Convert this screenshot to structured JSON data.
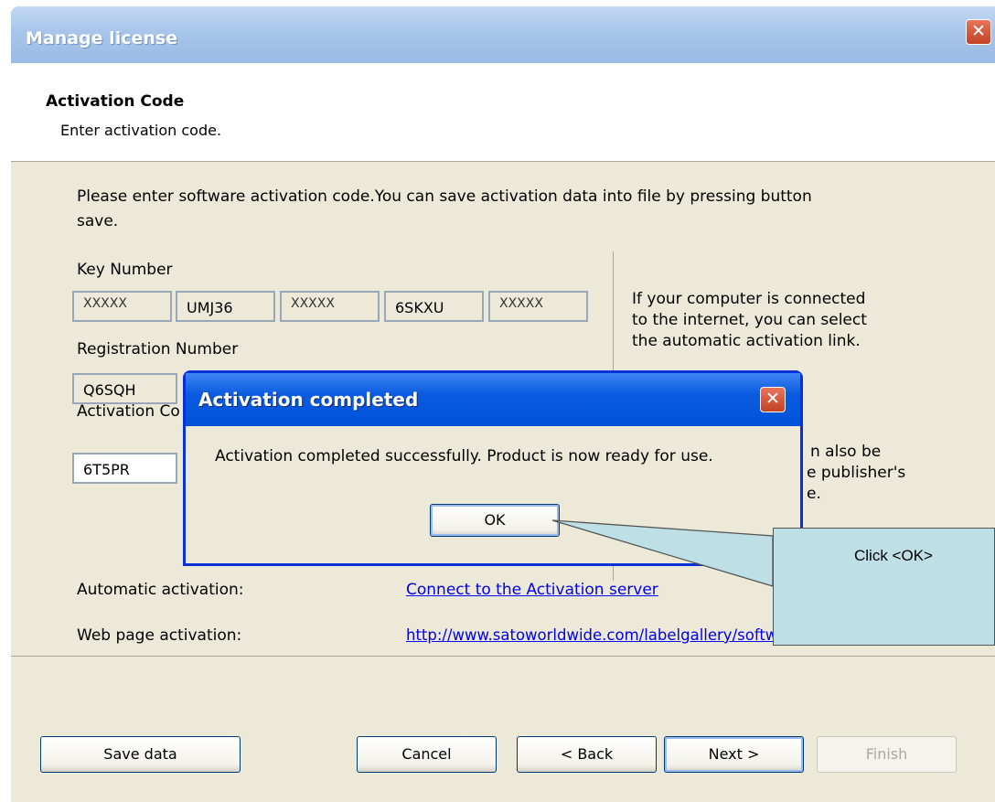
{
  "window": {
    "title": "Manage license",
    "close_label": "✕"
  },
  "header": {
    "title": "Activation Code",
    "subtitle": "Enter activation code."
  },
  "intro": {
    "line1": "Please enter software activation code.You can save activation data into file by pressing button",
    "line2": "save."
  },
  "key_number": {
    "label": "Key Number",
    "parts": [
      "XXXXX",
      "UMJ36",
      "XXXXX",
      "6SKXU",
      "XXXXX"
    ]
  },
  "registration_number": {
    "label": "Registration Number",
    "first": "Q6SQH"
  },
  "activation_code": {
    "label": "Activation Co",
    "first": "6T5PR"
  },
  "info": {
    "line1": "If your computer is connected",
    "line2": "to the internet, you can select",
    "line3": "the automatic activation link.",
    "line4": "n also be",
    "line5": "e publisher's",
    "line6": "e."
  },
  "automatic": {
    "label": "Automatic activation:",
    "link": "Connect to the Activation server"
  },
  "web": {
    "label": "Web page activation:",
    "link": "http://www.satoworldwide.com/labelgallery/software_index.htm"
  },
  "buttons": {
    "save": "Save data",
    "cancel": "Cancel",
    "back": "< Back",
    "next": "Next >",
    "finish": "Finish"
  },
  "dialog": {
    "title": "Activation completed",
    "message": "Activation completed successfully. Product is now ready for use.",
    "ok": "OK",
    "close_label": "✕"
  },
  "callout": {
    "text": "Click <OK>"
  }
}
